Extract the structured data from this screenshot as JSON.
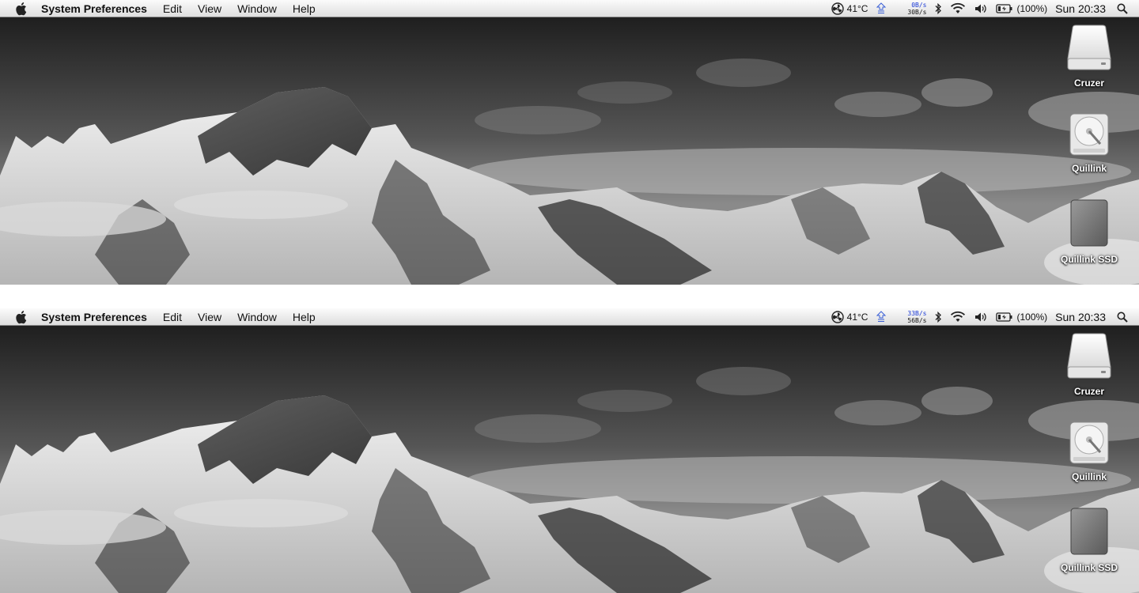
{
  "screens": [
    {
      "menubar": {
        "app_name": "System Preferences",
        "menus": [
          "Edit",
          "View",
          "Window",
          "Help"
        ],
        "temperature": "41°C",
        "net_up": "0B/s",
        "net_down": "30B/s",
        "battery": "(100%)",
        "clock": "Sun 20:33"
      },
      "desktop_icons": [
        "Cruzer",
        "Quillink",
        "Quillink SSD"
      ]
    },
    {
      "menubar": {
        "app_name": "System Preferences",
        "menus": [
          "Edit",
          "View",
          "Window",
          "Help"
        ],
        "temperature": "41°C",
        "net_up": "33B/s",
        "net_down": "56B/s",
        "battery": "(100%)",
        "clock": "Sun 20:33"
      },
      "desktop_icons": [
        "Cruzer",
        "Quillink",
        "Quillink SSD"
      ]
    }
  ],
  "icons": {
    "apple": "apple-logo-icon",
    "fan": "fan-icon",
    "net": "network-activity-icon",
    "bluetooth": "bluetooth-icon",
    "wifi": "wifi-icon",
    "volume": "volume-icon",
    "battery": "battery-icon",
    "spotlight": "spotlight-search-icon",
    "drives": [
      "external-drive-icon",
      "hard-disk-icon",
      "ssd-drive-icon"
    ]
  }
}
